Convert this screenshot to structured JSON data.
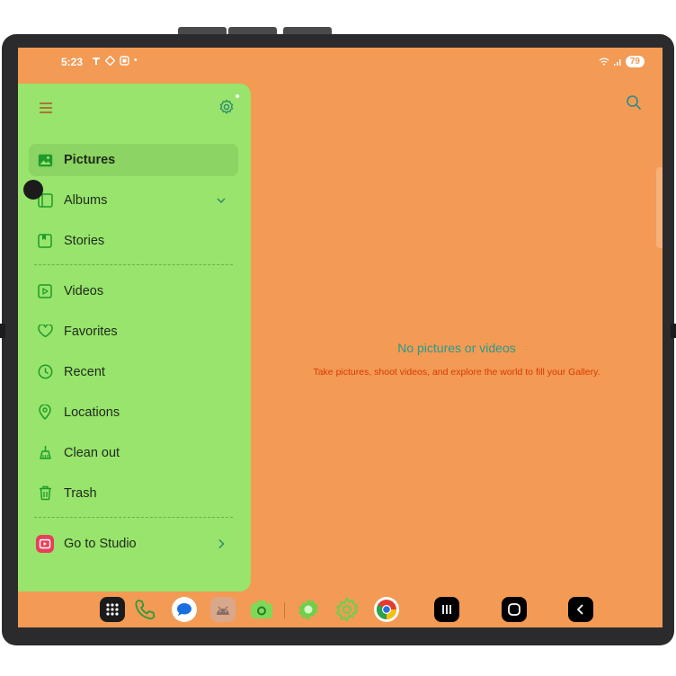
{
  "status_bar": {
    "time": "5:23",
    "battery": "79"
  },
  "drawer": {
    "items": [
      {
        "label": "Pictures",
        "icon": "picture-icon",
        "active": true
      },
      {
        "label": "Albums",
        "icon": "album-icon",
        "trailing": "chevron-down-icon"
      },
      {
        "label": "Stories",
        "icon": "stories-icon"
      },
      {
        "label": "Videos",
        "icon": "video-icon"
      },
      {
        "label": "Favorites",
        "icon": "heart-icon"
      },
      {
        "label": "Recent",
        "icon": "clock-icon"
      },
      {
        "label": "Locations",
        "icon": "location-pin-icon"
      },
      {
        "label": "Clean out",
        "icon": "broom-icon"
      },
      {
        "label": "Trash",
        "icon": "trash-icon"
      },
      {
        "label": "Go to Studio",
        "icon": "studio-icon",
        "trailing": "chevron-right-icon"
      }
    ]
  },
  "main": {
    "empty_title": "No pictures or videos",
    "empty_subtitle": "Take pictures, shoot videos, and explore the world to fill your Gallery."
  },
  "dock": {
    "apps": [
      "app-drawer-icon",
      "phone-icon",
      "messages-icon",
      "android-app-icon",
      "camera-icon",
      "settings-app-icon",
      "settings-gear-icon",
      "chrome-icon"
    ],
    "nav": [
      "recents-nav-icon",
      "home-nav-icon",
      "back-nav-icon"
    ]
  },
  "colors": {
    "screen_bg": "#f39a55",
    "drawer_bg": "#98e46c",
    "accent_green": "#1f9a2a",
    "empty_title": "#2a9a8a",
    "empty_subtitle": "#d83a00"
  }
}
